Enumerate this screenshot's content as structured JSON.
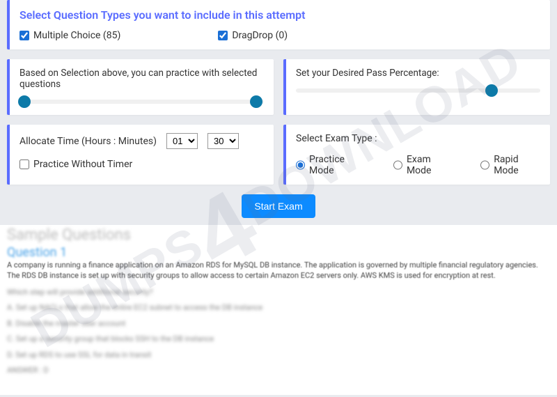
{
  "questionTypes": {
    "title": "Select Question Types you want to include in this attempt",
    "options": [
      {
        "label": "Multiple Choice (85)",
        "checked": true
      },
      {
        "label": "DragDrop (0)",
        "checked": true
      }
    ]
  },
  "practiceSlider": {
    "label": "Based on Selection above, you can practice with selected questions",
    "min_pos": 2,
    "max_pos": 97
  },
  "passSlider": {
    "label": "Set your Desired Pass Percentage:",
    "pos": 80
  },
  "time": {
    "label": "Allocate Time (Hours : Minutes)",
    "hours": "01",
    "minutes": "30",
    "noTimerLabel": "Practice Without Timer",
    "noTimerChecked": false
  },
  "examType": {
    "label": "Select Exam Type :",
    "options": [
      "Practice Mode",
      "Exam Mode",
      "Rapid Mode"
    ],
    "selected": 0
  },
  "startButton": "Start Exam",
  "sample": {
    "heading": "Sample Questions",
    "q1": "Question 1",
    "readable": "A company is running a finance application on an Amazon RDS for MySQL DB instance. The application is governed by multiple financial regulatory agencies. The RDS DB instance is set up with security groups to allow access to certain Amazon EC2 servers only. AWS KMS is used for encryption at rest.",
    "blur1": "Which step will provide additional security?",
    "blur2": "A. Set up NACLs that allow the entire EC2 subnet to access the DB instance",
    "blur3": "B. Disable the master user account",
    "blur4": "C. Set up a security group that blocks SSH to the DB instance",
    "blur5": "D. Set up RDS to use SSL for data in transit",
    "ans": "ANSWER : D"
  },
  "watermark": {
    "left": "DUMPS",
    "mid": "4",
    "right": "DOWNLOAD"
  }
}
